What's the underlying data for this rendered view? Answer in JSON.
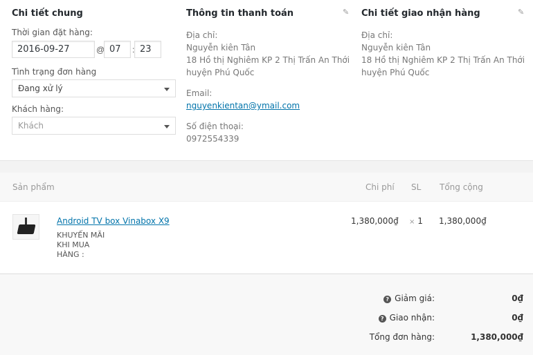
{
  "general": {
    "title": "Chi tiết chung",
    "date_label": "Thời gian đặt hàng:",
    "date_value": "2016-09-27",
    "at_symbol": "@",
    "hour_value": "07",
    "time_sep": ":",
    "minute_value": "23",
    "status_label": "Tình trạng đơn hàng",
    "status_value": "Đang xử lý",
    "customer_label": "Khách hàng:",
    "customer_placeholder": "Khách"
  },
  "billing": {
    "title": "Thông tin thanh toán",
    "address_label": "Địa chỉ:",
    "name": "Nguyễn kiên Tân",
    "street": "18 Hồ thị Nghiêm KP 2 Thị Trấn An Thới",
    "district": "huyện Phú Quốc",
    "email_label": "Email:",
    "email": "nguyenkientan@ymail.com",
    "phone_label": "Số điện thoại:",
    "phone": "0972554339"
  },
  "shipping": {
    "title": "Chi tiết giao nhận hàng",
    "address_label": "Địa chỉ:",
    "name": "Nguyễn kiên Tân",
    "street": "18 Hồ thị Nghiêm KP 2 Thị Trấn An Thới",
    "district": "huyện Phú Quốc"
  },
  "items_table": {
    "headers": {
      "product": "Sản phẩm",
      "cost": "Chi phí",
      "qty": "SL",
      "total": "Tổng cộng"
    },
    "rows": [
      {
        "name": "Android TV box Vinabox X9",
        "meta_line1": "KHUYẾN MÃI",
        "meta_line2": "KHI MUA",
        "meta_line3": "HÀNG :",
        "cost": "1,380,000₫",
        "qty_symbol": "×",
        "qty": "1",
        "total": "1,380,000₫"
      }
    ]
  },
  "totals": {
    "discount_label": "Giảm giá:",
    "discount_value": "0₫",
    "shipping_label": "Giao nhận:",
    "shipping_value": "0₫",
    "order_total_label": "Tổng đơn hàng:",
    "order_total_value": "1,380,000₫"
  },
  "icons": {
    "edit": "pencil-icon",
    "help": "question-icon",
    "dropdown": "caret-down-icon"
  },
  "colors": {
    "link": "#0073aa",
    "heading": "#23282d"
  }
}
